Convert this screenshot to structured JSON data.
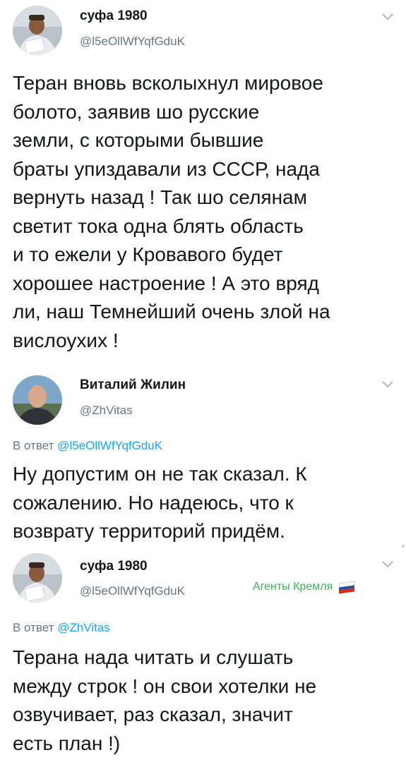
{
  "tweet1": {
    "name": "суфа 1980",
    "handle": "@l5eOllWfYqfGduK",
    "lines": [
      "Теран вновь всколыхнул мировое",
      "болото, заявив шо русские",
      "земли, с которыми бывшие",
      "браты упиздавали из СССР, нада",
      "вернуть назад ! Так шо селянам",
      "светит тока одна блять область",
      "и то ежели у Кровавого будет",
      "хорошее настроение ! А это вряд",
      "ли, наш Темнейший очень злой на",
      "вислоухих !"
    ]
  },
  "tweet2": {
    "name": "Виталий Жилин",
    "handle": "@ZhVitas",
    "reply_prefix": "В ответ",
    "reply_mention": "@l5eOllWfYqfGduK",
    "lines": [
      "Ну допустим он не так сказал. К",
      "сожалению. Но надеюсь, что к",
      "возврату территорий придём."
    ]
  },
  "tweet3": {
    "name": "суфа 1980",
    "handle": "@l5eOllWfYqfGduK",
    "reply_prefix": "В ответ",
    "reply_mention": "@ZhVitas",
    "lines": [
      "Терана нада читать и слушать",
      "между строк ! он свои хотелки не",
      "озвучивает, раз сказал, значит",
      "есть план !)"
    ]
  },
  "watermark": {
    "text": "Агенты Кремля",
    "icon": "russian-flag-icon",
    "color": "#3fae5a"
  },
  "colors": {
    "text": "#14171a",
    "secondary": "#657786",
    "link": "#1da1f2"
  }
}
